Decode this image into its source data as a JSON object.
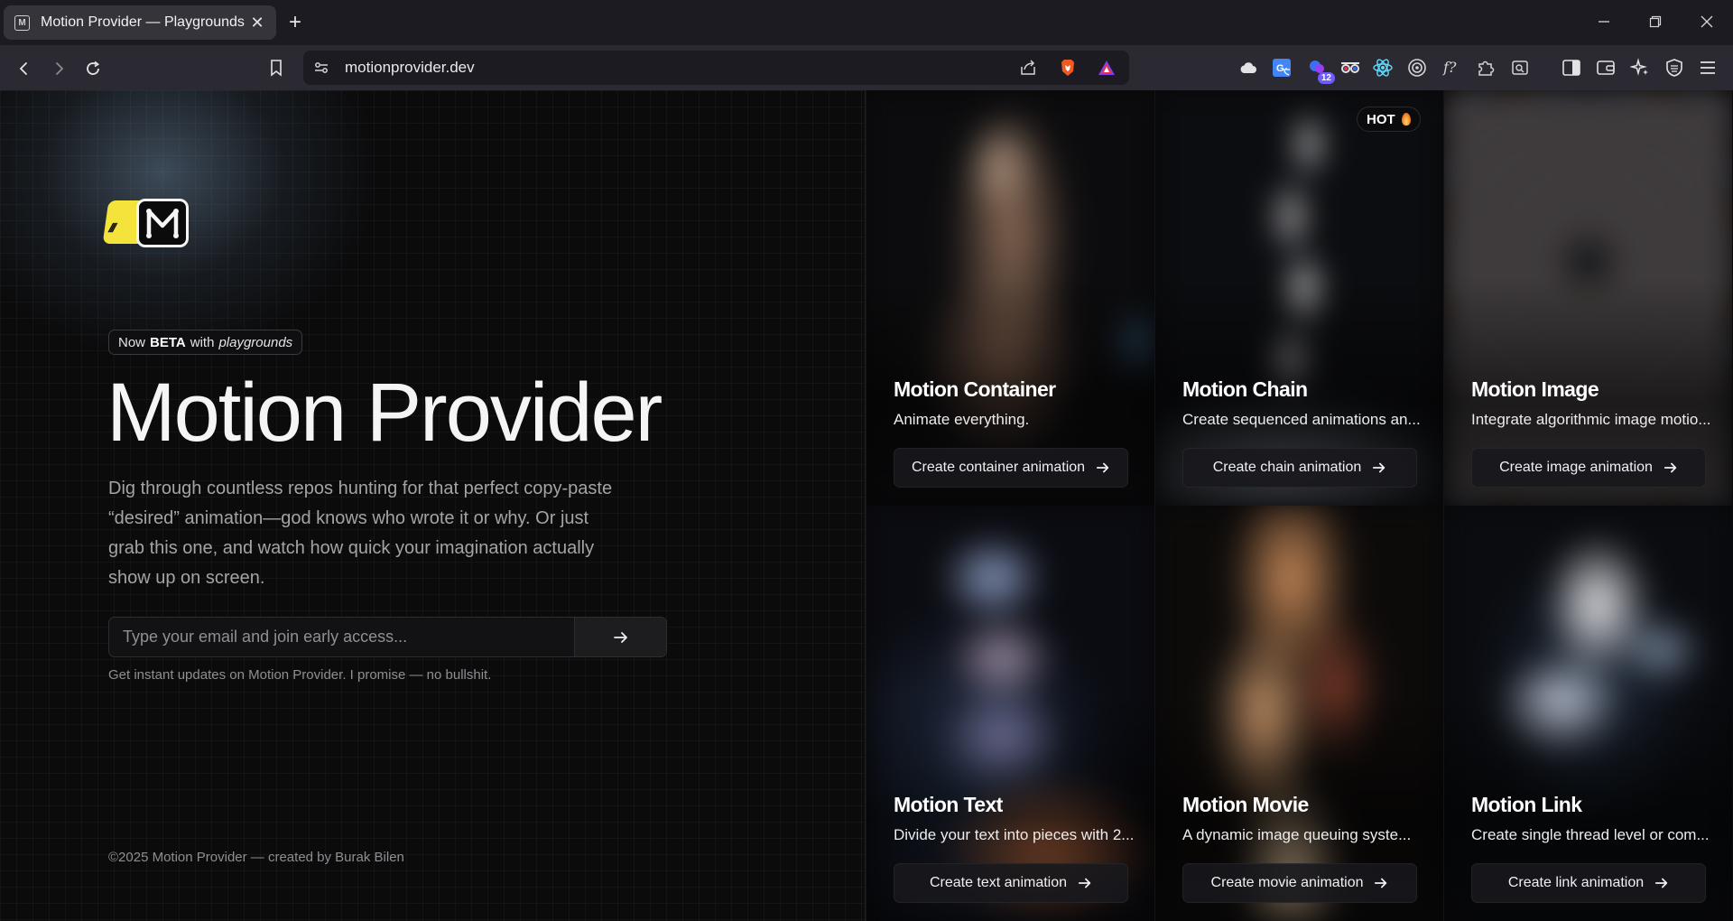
{
  "browser": {
    "tab_title": "Motion Provider — Playgrounds",
    "tab_favicon_letter": "M",
    "tab_close": "✕",
    "new_tab": "+",
    "url": "motionprovider.dev",
    "extensions": [
      "cloud-icon",
      "translate-icon",
      "extension-badge-icon",
      "glasses-icon",
      "react-icon",
      "target-icon",
      "function-icon",
      "puzzle-icon",
      "reader-icon",
      "sidebar-icon",
      "wallet-icon",
      "leo-ai-icon",
      "vpn-shield-icon",
      "menu-icon"
    ],
    "extension_badge": "12"
  },
  "hero": {
    "badge_prefix": "Now",
    "badge_bold": "BETA",
    "badge_mid": "with",
    "badge_italic": "playgrounds",
    "title": "Motion Provider",
    "description": "Dig through countless repos hunting for that perfect copy-paste “desired” animation—god knows who wrote it or why. Or just grab this one, and watch how quick your imagination actually show up on screen.",
    "email_placeholder": "Type your email and join early access...",
    "form_note": "Get instant updates on Motion Provider. I promise — no bullshit.",
    "footer": "©2025 Motion Provider — created by Burak Bilen"
  },
  "cards": [
    {
      "title": "Motion Container",
      "description": "Animate everything.",
      "button": "Create container animation"
    },
    {
      "title": "Motion Chain",
      "description": "Create sequenced animations an...",
      "button": "Create chain animation",
      "badge": "HOT"
    },
    {
      "title": "Motion Image",
      "description": "Integrate algorithmic image motio...",
      "button": "Create image animation"
    },
    {
      "title": "Motion Text",
      "description": "Divide your text into pieces with 2...",
      "button": "Create text animation"
    },
    {
      "title": "Motion Movie",
      "description": "A dynamic image queuing syste...",
      "button": "Create movie animation"
    },
    {
      "title": "Motion Link",
      "description": "Create single thread level or com...",
      "button": "Create link animation"
    }
  ],
  "colors": {
    "background": "#0b0b0c",
    "chrome_tabbar": "#1c1b22",
    "chrome_navbar": "#2b2a33",
    "logo_yellow": "#f4e33b",
    "text_primary": "#f5f5f6",
    "text_muted": "#a4a4a8"
  }
}
